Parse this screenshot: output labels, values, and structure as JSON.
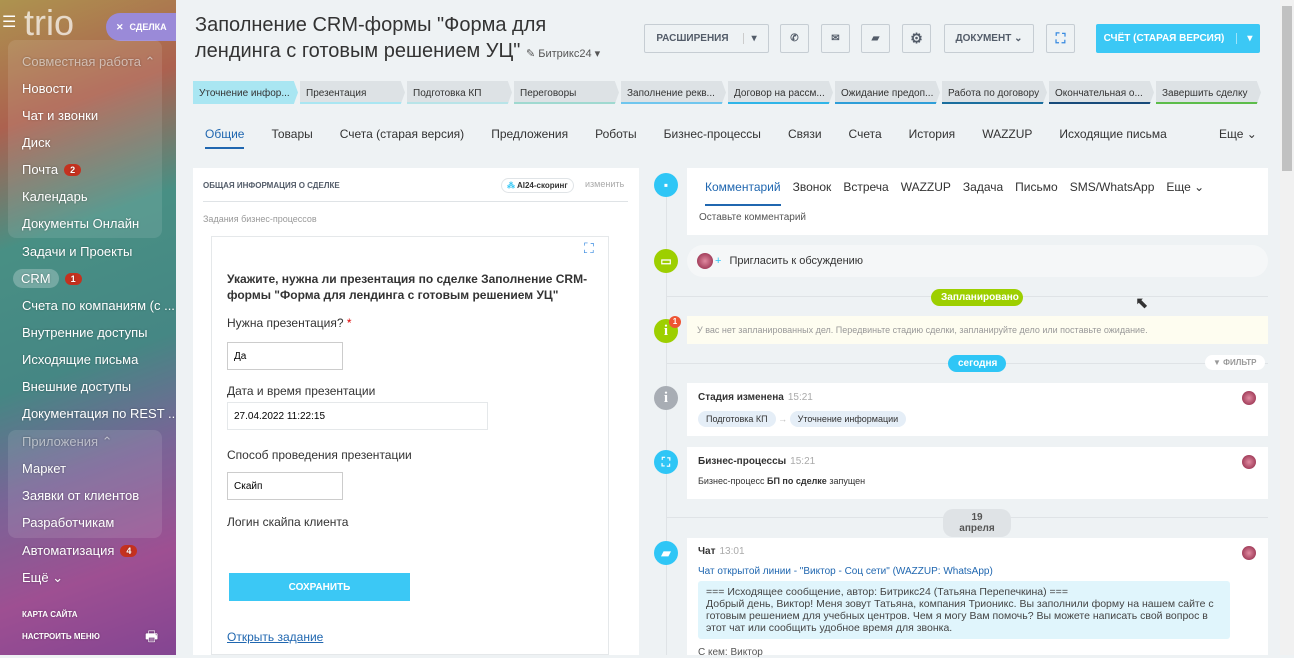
{
  "sidebar": {
    "logo": "trio",
    "deal_button": "СДЕЛКА",
    "items": [
      {
        "label": "Совместная работа ⌃",
        "type": "header"
      },
      {
        "label": "Новости"
      },
      {
        "label": "Чат и звонки"
      },
      {
        "label": "Диск"
      },
      {
        "label": "Почта",
        "badge": "2"
      },
      {
        "label": "Календарь"
      },
      {
        "label": "Документы Онлайн"
      },
      {
        "label": "Задачи и Проекты"
      },
      {
        "label": "CRM",
        "badge": "1"
      },
      {
        "label": "Счета по компаниям (с ..."
      },
      {
        "label": "Внутренние доступы"
      },
      {
        "label": "Исходящие письма"
      },
      {
        "label": "Внешние доступы"
      },
      {
        "label": "Документация по REST ..."
      },
      {
        "label": "Приложения ⌃",
        "type": "header"
      },
      {
        "label": "Маркет"
      },
      {
        "label": "Заявки от клиентов"
      },
      {
        "label": "Разработчикам"
      },
      {
        "label": "Автоматизация",
        "badge": "4"
      },
      {
        "label": "Ещё ⌄"
      }
    ],
    "site_map": "КАРТА САЙТА",
    "configure_menu": "НАСТРОИТЬ МЕНЮ"
  },
  "header": {
    "title": "Заполнение CRM-формы \"Форма для лендинга с готовым решением  УЦ\"",
    "category": "Битрикс24",
    "extensions": "РАСШИРЕНИЯ",
    "document": "ДОКУМЕНТ",
    "invoice": "СЧЁТ (СТАРАЯ ВЕРСИЯ)"
  },
  "stages": [
    {
      "label": "Уточнение инфор...",
      "color": "#a9e6f2"
    },
    {
      "label": "Презентация",
      "color": "#a9e6f2"
    },
    {
      "label": "Подготовка КП",
      "color": "#b8e4e8"
    },
    {
      "label": "Переговоры",
      "color": "#9fd9d0"
    },
    {
      "label": "Заполнение рекв...",
      "color": "#6fc6ee"
    },
    {
      "label": "Договор на рассм...",
      "color": "#2fb5e8"
    },
    {
      "label": "Ожидание предоп...",
      "color": "#2e9ed8"
    },
    {
      "label": "Работа по договору",
      "color": "#1a6e9e"
    },
    {
      "label": "Окончательная о...",
      "color": "#174a7a"
    },
    {
      "label": "Завершить сделку",
      "color": "#5cbd4a"
    }
  ],
  "tabs": [
    "Общие",
    "Товары",
    "Счета (старая версия)",
    "Предложения",
    "Роботы",
    "Бизнес-процессы",
    "Связи",
    "Счета",
    "История",
    "WAZZUP",
    "Исходящие письма"
  ],
  "tabs_more": "Еще",
  "info": {
    "title": "ОБЩАЯ ИНФОРМАЦИЯ О СДЕЛКЕ",
    "ai": "AI24-скоринг",
    "edit": "изменить",
    "bp_tasks": "Задания бизнес-процессов",
    "task_title": "Укажите, нужна ли презентация по сделке Заполнение CRM-формы \"Форма для лендинга с готовым решением УЦ\"",
    "q1": "Нужна презентация?",
    "q1_value": "Да",
    "q2": "Дата и время презентации",
    "q2_value": "27.04.2022 11:22:15",
    "q3": "Способ проведения презентации",
    "q3_value": "Скайп",
    "q4": "Логин скайпа клиента",
    "save": "СОХРАНИТЬ",
    "open_task": "Открыть задание"
  },
  "timeline": {
    "tabs": [
      "Комментарий",
      "Звонок",
      "Встреча",
      "WAZZUP",
      "Задача",
      "Письмо",
      "SMS/WhatsApp",
      "Еще"
    ],
    "comment_placeholder": "Оставьте комментарий",
    "invite": "Пригласить к обсуждению",
    "planned": "Запланировано",
    "no_plans": "У вас нет запланированных дел. Передвиньте стадию сделки, запланируйте дело или поставьте ожидание.",
    "no_plans_badge": "1",
    "today": "сегодня",
    "filter": "ФИЛЬТР",
    "stage_changed": "Стадия изменена",
    "stage_time": "15:21",
    "stage_from": "Подготовка КП",
    "stage_to": "Уточнение информации",
    "bp": "Бизнес-процессы",
    "bp_time": "15:21",
    "bp_text_1": "Бизнес-процесс ",
    "bp_text_bold": "БП по сделке",
    "bp_text_2": " запущен",
    "date_sep": "19 апреля",
    "chat": "Чат",
    "chat_time": "13:01",
    "chat_link": "Чат открытой линии - \"Виктор - Соц сети\" (WAZZUP: WhatsApp)",
    "chat_msg_head": "=== Исходящее сообщение, автор: Битрикс24 (Татьяна Перепечкина) ===",
    "chat_msg": "Добрый день, Виктор! Меня зовут Татьяна, компания Трионикс. Вы заполнили форму на нашем сайте с готовым решением для учебных центров. Чем я могу Вам помочь? Вы можете написать свой вопрос в этот чат или сообщить удобное время для звонка.",
    "chat_with": "С кем: Виктор"
  }
}
